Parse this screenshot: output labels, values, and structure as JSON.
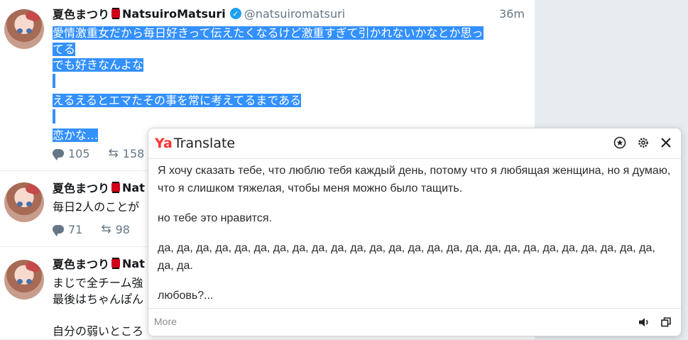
{
  "tweets": [
    {
      "display_name": "夏色まつり",
      "username": "NatsuiroMatsuri",
      "handle": "@natsuiromatsuri",
      "time": "36m",
      "lines": [
        "愛情激重女だから毎日好きって伝えたくなるけど激重すぎて引かれないかなとか思っ",
        "てる",
        "でも好きなんよな",
        "",
        "えるえるとエマたその事を常に考えてるまである",
        "",
        "恋かな…"
      ],
      "replies": "105",
      "retweets": "158"
    },
    {
      "display_name": "夏色まつり",
      "username_partial": "Nat",
      "lines": [
        "毎日2人のことが"
      ],
      "replies": "71",
      "retweets": "98"
    },
    {
      "display_name": "夏色まつり",
      "username_partial": "Nat",
      "lines": [
        "まじで全チーム強",
        "最後はちゃんぽん",
        "",
        "自分の弱いところ"
      ]
    }
  ],
  "translate": {
    "logo_ya": "Ya",
    "logo_rest": "Translate",
    "paragraphs": [
      "Я хочу сказать тебе, что люблю тебя каждый день, потому что я любящая женщина, но я думаю, что я слишком тяжелая, чтобы меня можно было тащить.",
      "но тебе это нравится.",
      "да, да, да, да, да, да, да, да, да, да, да, да, да, да, да, да, да, да, да, да, да, да, да, да, да, да, да, да.",
      "любовь?..."
    ],
    "more_label": "More",
    "icons": [
      "star-icon",
      "gear-icon",
      "close-icon",
      "speaker-icon",
      "copy-icon"
    ]
  },
  "colors": {
    "selection": "#3390ff",
    "brand_red": "#ff3333",
    "verified": "#1da1f2"
  }
}
